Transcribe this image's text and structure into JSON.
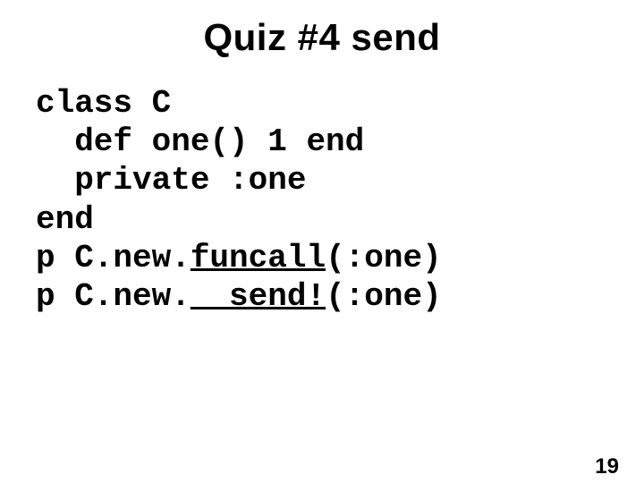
{
  "title": "Quiz #4 send",
  "code": {
    "line1_a": "class C",
    "line2_a": "  def one() 1 end",
    "line3_a": "  private :one",
    "line4_a": "end",
    "line5_a": "p C.new.",
    "line5_id": "funcall",
    "line5_b": "(:one)",
    "line6_a": "p C.new.",
    "line6_id": "__send!",
    "line6_b": "(:one)"
  },
  "page_number": "19"
}
